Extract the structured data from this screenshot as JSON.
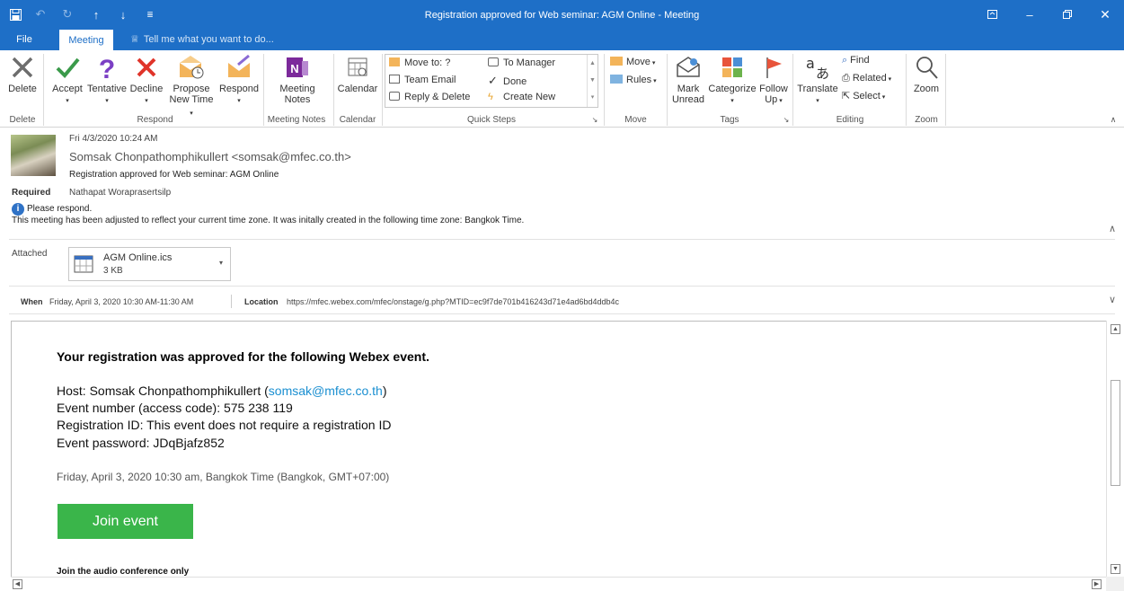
{
  "window": {
    "title": "Registration approved for Web seminar: AGM Online - Meeting"
  },
  "tabs": [
    {
      "label": "File"
    },
    {
      "label": "Meeting"
    }
  ],
  "tell_me": "Tell me what you want to do...",
  "ribbon": {
    "delete": {
      "label": "Delete",
      "group": "Delete"
    },
    "respond": {
      "accept": "Accept",
      "tentative": "Tentative",
      "decline": "Decline",
      "propose_line1": "Propose",
      "propose_line2": "New Time",
      "respond": "Respond",
      "group": "Respond"
    },
    "meeting_notes": {
      "line1": "Meeting",
      "line2": "Notes",
      "group": "Meeting Notes"
    },
    "calendar": {
      "label": "Calendar",
      "group": "Calendar"
    },
    "quick_steps": {
      "move_to": "Move to: ?",
      "team_email": "Team Email",
      "reply_delete": "Reply & Delete",
      "to_manager": "To Manager",
      "done": "Done",
      "create_new": "Create New",
      "group": "Quick Steps"
    },
    "move": {
      "move": "Move",
      "rules": "Rules",
      "group": "Move"
    },
    "tags": {
      "mark_unread_line1": "Mark",
      "mark_unread_line2": "Unread",
      "categorize": "Categorize",
      "follow_up_line1": "Follow",
      "follow_up_line2": "Up",
      "group": "Tags"
    },
    "editing": {
      "translate": "Translate",
      "find": "Find",
      "related": "Related",
      "select": "Select",
      "group": "Editing"
    },
    "zoom": {
      "label": "Zoom",
      "group": "Zoom"
    }
  },
  "header": {
    "date": "Fri 4/3/2020 10:24 AM",
    "sender": "Somsak Chonpathomphikullert <somsak@mfec.co.th>",
    "subject": "Registration approved for Web seminar: AGM Online",
    "required_label": "Required",
    "required_value": "Nathapat Woraprasertsilp",
    "info_line1": "Please respond.",
    "info_line2": "This meeting has been adjusted to reflect your current time zone. It was initally created in the following time zone: Bangkok Time.",
    "attached_label": "Attached",
    "attachment_name": "AGM Online.ics",
    "attachment_size": "3 KB",
    "when_label": "When",
    "when_value": "Friday, April 3, 2020 10:30 AM-11:30 AM",
    "location_label": "Location",
    "location_value": "https://mfec.webex.com/mfec/onstage/g.php?MTID=ec9f7de701b416243d71e4ad6bd4ddb4c"
  },
  "body": {
    "heading": "Your registration was approved for the following Webex event.",
    "host_prefix": "Host: Somsak Chonpathomphikullert (",
    "host_email": "somsak@mfec.co.th",
    "host_suffix": ")",
    "event_number": "Event number (access code): 575 238 119",
    "registration_id": "Registration ID: This event does not require a registration ID",
    "event_password": "Event password: JDqBjafz852",
    "datetime": "Friday, April 3, 2020 10:30 am, Bangkok Time (Bangkok, GMT+07:00)",
    "join_button": "Join event",
    "audio_heading": "Join the audio conference only"
  },
  "colors": {
    "accent": "#1e6fc7",
    "join_button": "#3ab54a",
    "link": "#1a8fd1"
  }
}
